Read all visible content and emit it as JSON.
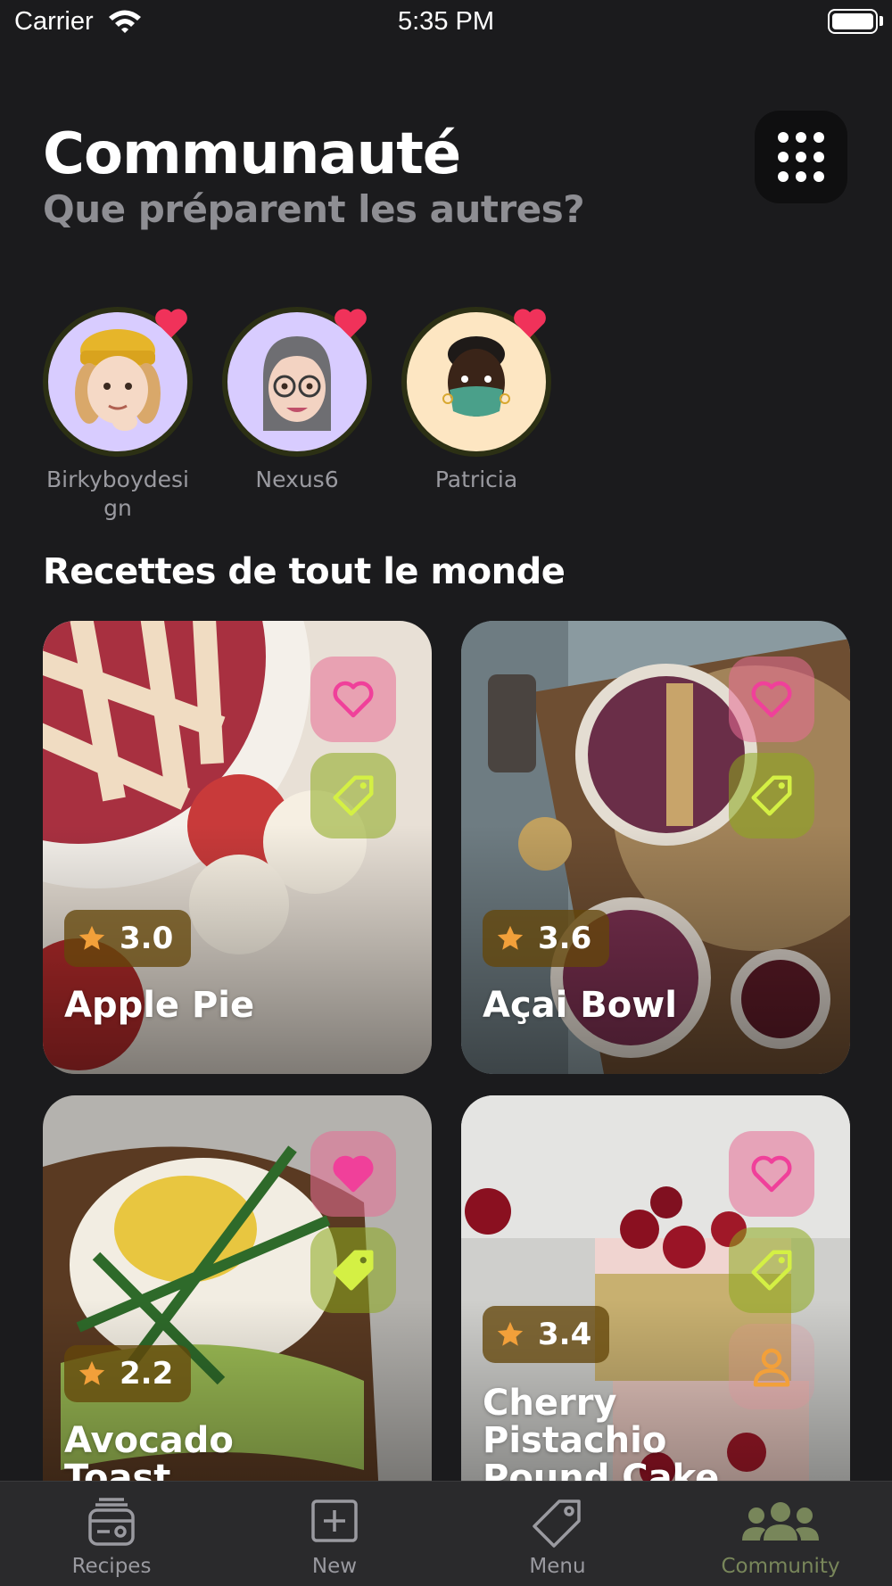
{
  "status_bar": {
    "carrier": "Carrier",
    "time": "5:35 PM"
  },
  "header": {
    "title": "Communauté",
    "subtitle": "Que préparent les autres?"
  },
  "stories": [
    {
      "name": "Birkyboydesi gn",
      "bg": "#d8ccff"
    },
    {
      "name": "Nexus6",
      "bg": "#d8ccff"
    },
    {
      "name": "Patricia",
      "bg": "#fde6c2"
    }
  ],
  "section_title": "Recettes de tout le monde",
  "recipes": [
    {
      "title": "Apple Pie",
      "rating": "3.0",
      "favorited": false
    },
    {
      "title": "Açai Bowl",
      "rating": "3.6",
      "favorited": false
    },
    {
      "title": "Avocado Toast",
      "rating": "2.2",
      "favorited": true
    },
    {
      "title": "Cherry Pistachio Pound Cake",
      "rating": "3.4",
      "favorited": false
    }
  ],
  "tab_bar": {
    "tabs": [
      {
        "label": "Recipes",
        "icon": "recipes-icon"
      },
      {
        "label": "New",
        "icon": "new-icon"
      },
      {
        "label": "Menu",
        "icon": "menu-tag-icon"
      },
      {
        "label": "Community",
        "icon": "community-icon",
        "active": true
      }
    ]
  },
  "colors": {
    "background": "#1b1b1d",
    "heart": "#f0325a",
    "accent_green": "#d4f044",
    "star": "#f2a03a",
    "active_tab": "#78865a"
  }
}
